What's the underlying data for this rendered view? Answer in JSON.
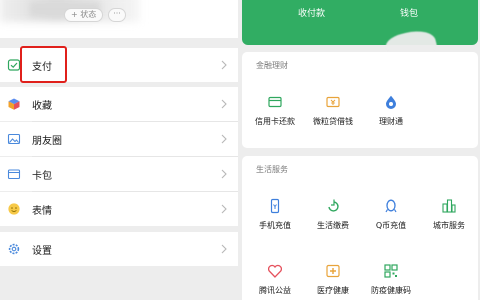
{
  "profile": {
    "status_label": "+ 状态",
    "more_label": "···"
  },
  "menu": {
    "pay": "支付",
    "favorites": "收藏",
    "moments": "朋友圈",
    "cards": "卡包",
    "stickers": "表情",
    "settings": "设置"
  },
  "wallet_bar": {
    "collect": "收付款",
    "wallet": "钱包"
  },
  "finance": {
    "title": "金融理财",
    "items": [
      "信用卡还款",
      "微粒贷借钱",
      "理财通"
    ]
  },
  "life": {
    "title": "生活服务",
    "items": [
      "手机充值",
      "生活缴费",
      "Q币充值",
      "城市服务",
      "腾讯公益",
      "医疗健康",
      "防疫健康码"
    ]
  },
  "colors": {
    "green": "#31ad63",
    "highlight_red": "#e0201b",
    "background": "#ededed"
  },
  "icons": {
    "pay": "pay-icon",
    "favorites": "cube-icon",
    "moments": "image-icon",
    "cards": "wallet-icon",
    "stickers": "smiley-icon",
    "settings": "gear-icon"
  }
}
